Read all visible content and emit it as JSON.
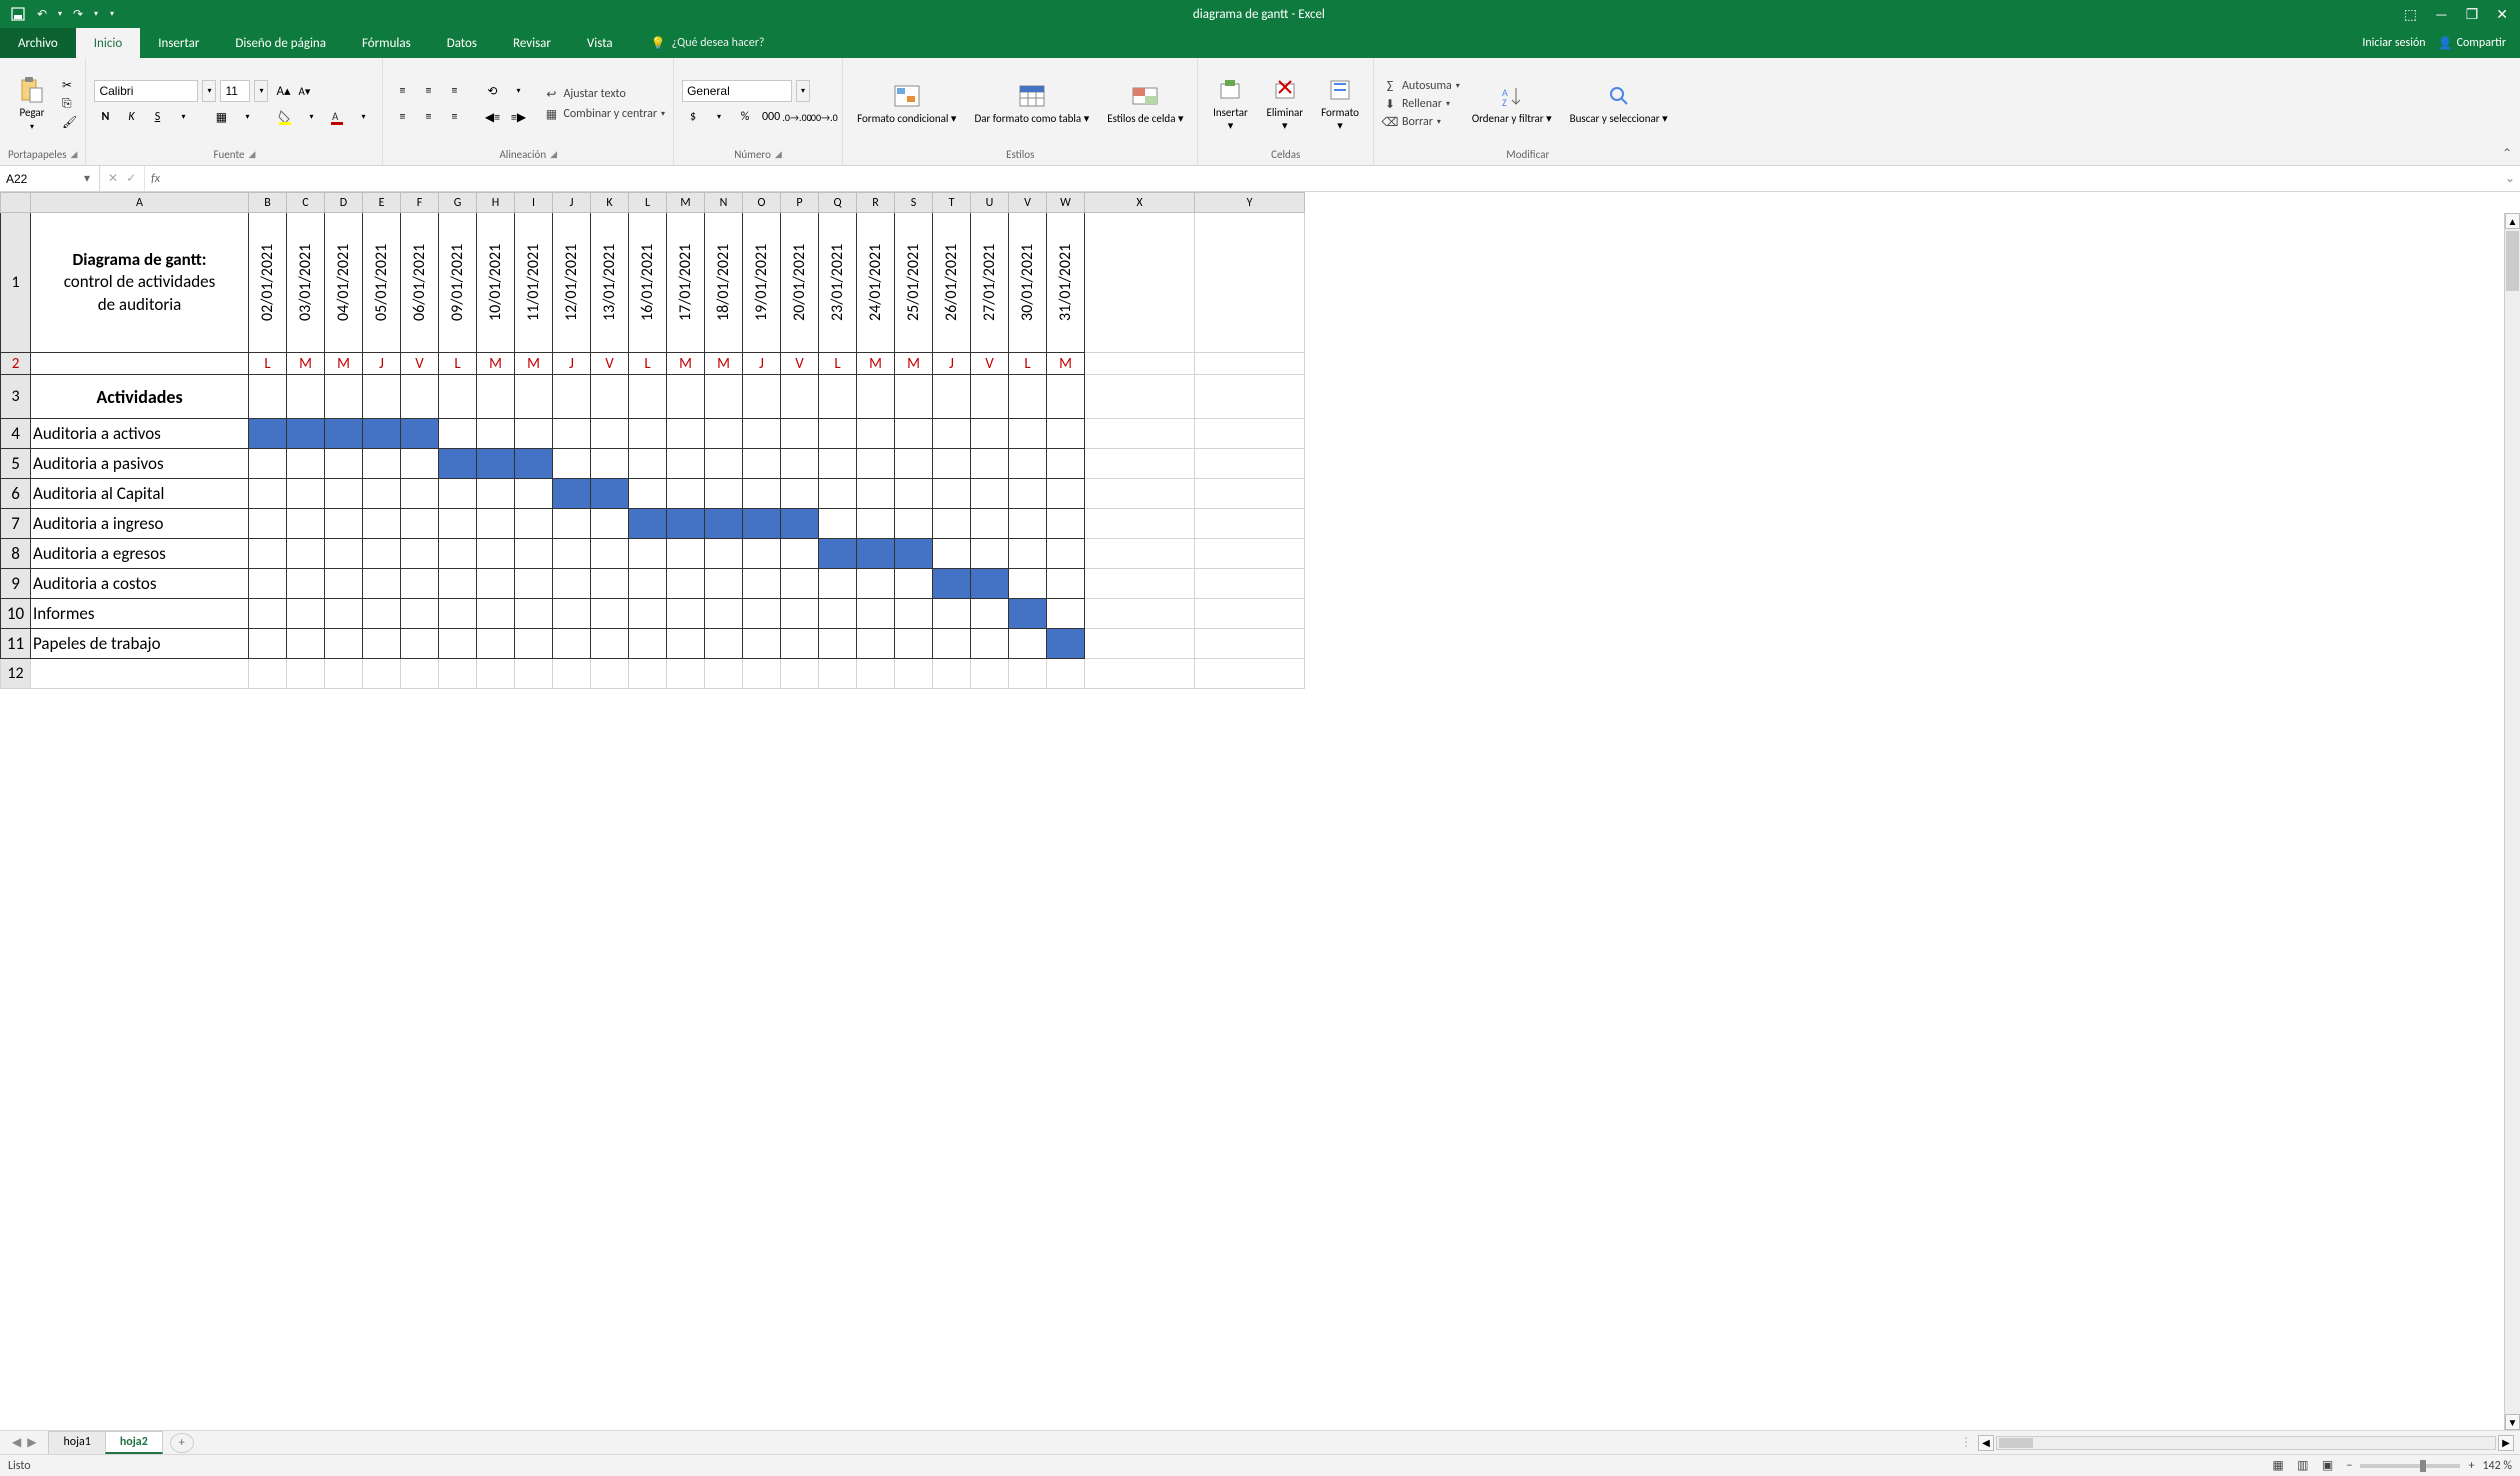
{
  "titlebar": {
    "title": "diagrama de gantt - Excel"
  },
  "win_controls": {
    "ribbon_opts": "⬚",
    "min": "—",
    "max": "❐",
    "close": "✕"
  },
  "tabs": {
    "file": "Archivo",
    "list": [
      "Inicio",
      "Insertar",
      "Diseño de página",
      "Fórmulas",
      "Datos",
      "Revisar",
      "Vista"
    ],
    "active": "Inicio",
    "tell_me": "¿Qué desea hacer?",
    "signin": "Iniciar sesión",
    "share": "Compartir"
  },
  "ribbon": {
    "clipboard": {
      "paste": "Pegar",
      "label": "Portapapeles"
    },
    "font": {
      "name": "Calibri",
      "size": "11",
      "bold": "N",
      "italic": "K",
      "underline": "S",
      "label": "Fuente"
    },
    "alignment": {
      "wrap": "Ajustar texto",
      "merge": "Combinar y centrar",
      "label": "Alineación"
    },
    "number": {
      "format": "General",
      "percent": "%",
      "thousands": "000",
      "label": "Número"
    },
    "styles": {
      "cond": "Formato condicional",
      "table": "Dar formato como tabla",
      "cell": "Estilos de celda",
      "label": "Estilos"
    },
    "cells": {
      "insert": "Insertar",
      "delete": "Eliminar",
      "format": "Formato",
      "label": "Celdas"
    },
    "editing": {
      "autosum": "Autosuma",
      "fill": "Rellenar",
      "clear": "Borrar",
      "sort": "Ordenar y filtrar",
      "find": "Buscar y seleccionar",
      "label": "Modificar"
    }
  },
  "namebox": "A22",
  "columns": [
    "A",
    "B",
    "C",
    "D",
    "E",
    "F",
    "G",
    "H",
    "I",
    "J",
    "K",
    "L",
    "M",
    "N",
    "O",
    "P",
    "Q",
    "R",
    "S",
    "T",
    "U",
    "V",
    "W",
    "X",
    "Y"
  ],
  "row_numbers": [
    1,
    2,
    3,
    4,
    5,
    6,
    7,
    8,
    9,
    10,
    11,
    12
  ],
  "gantt": {
    "title_bold": "Diagrama de gantt:",
    "title_rest1": "control de actividades",
    "title_rest2": "de auditoria",
    "activities_header": "Actividades",
    "dates": [
      "02/01/2021",
      "03/01/2021",
      "04/01/2021",
      "05/01/2021",
      "06/01/2021",
      "09/01/2021",
      "10/01/2021",
      "11/01/2021",
      "12/01/2021",
      "13/01/2021",
      "16/01/2021",
      "17/01/2021",
      "18/01/2021",
      "19/01/2021",
      "20/01/2021",
      "23/01/2021",
      "24/01/2021",
      "25/01/2021",
      "26/01/2021",
      "27/01/2021",
      "30/01/2021",
      "31/01/2021"
    ],
    "days": [
      "L",
      "M",
      "M",
      "J",
      "V",
      "L",
      "M",
      "M",
      "J",
      "V",
      "L",
      "M",
      "M",
      "J",
      "V",
      "L",
      "M",
      "M",
      "J",
      "V",
      "L",
      "M"
    ],
    "activities": [
      {
        "name": "Auditoria a activos",
        "fill": [
          0,
          1,
          2,
          3,
          4
        ]
      },
      {
        "name": "Auditoria a pasivos",
        "fill": [
          5,
          6,
          7
        ]
      },
      {
        "name": "Auditoria al Capital",
        "fill": [
          8,
          9
        ]
      },
      {
        "name": "Auditoria a ingreso",
        "fill": [
          10,
          11,
          12,
          13,
          14
        ]
      },
      {
        "name": "Auditoria a egresos",
        "fill": [
          15,
          16,
          17
        ]
      },
      {
        "name": "Auditoria a costos",
        "fill": [
          18,
          19
        ]
      },
      {
        "name": "Informes",
        "fill": [
          20
        ]
      },
      {
        "name": "Papeles de trabajo",
        "fill": [
          21
        ]
      }
    ]
  },
  "chart_data": {
    "type": "gantt",
    "title": "Diagrama de gantt: control de actividades de auditoria",
    "x_categories": [
      "02/01/2021",
      "03/01/2021",
      "04/01/2021",
      "05/01/2021",
      "06/01/2021",
      "09/01/2021",
      "10/01/2021",
      "11/01/2021",
      "12/01/2021",
      "13/01/2021",
      "16/01/2021",
      "17/01/2021",
      "18/01/2021",
      "19/01/2021",
      "20/01/2021",
      "23/01/2021",
      "24/01/2021",
      "25/01/2021",
      "26/01/2021",
      "27/01/2021",
      "30/01/2021",
      "31/01/2021"
    ],
    "series": [
      {
        "name": "Auditoria a activos",
        "start": "02/01/2021",
        "end": "06/01/2021"
      },
      {
        "name": "Auditoria a pasivos",
        "start": "09/01/2021",
        "end": "11/01/2021"
      },
      {
        "name": "Auditoria al Capital",
        "start": "12/01/2021",
        "end": "13/01/2021"
      },
      {
        "name": "Auditoria a ingreso",
        "start": "16/01/2021",
        "end": "20/01/2021"
      },
      {
        "name": "Auditoria a egresos",
        "start": "23/01/2021",
        "end": "25/01/2021"
      },
      {
        "name": "Auditoria a costos",
        "start": "26/01/2021",
        "end": "27/01/2021"
      },
      {
        "name": "Informes",
        "start": "30/01/2021",
        "end": "30/01/2021"
      },
      {
        "name": "Papeles de trabajo",
        "start": "31/01/2021",
        "end": "31/01/2021"
      }
    ]
  },
  "sheets": {
    "list": [
      "hoja1",
      "hoja2"
    ],
    "active": "hoja2"
  },
  "statusbar": {
    "ready": "Listo",
    "zoom": "142 %"
  }
}
